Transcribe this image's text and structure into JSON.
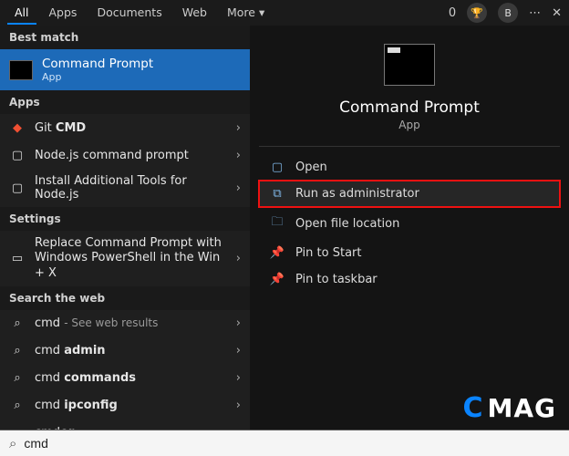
{
  "tabs": {
    "all": "All",
    "apps": "Apps",
    "documents": "Documents",
    "web": "Web",
    "more": "More",
    "points": "0",
    "avatar": "B"
  },
  "bestMatch": {
    "header": "Best match",
    "title": "Command Prompt",
    "subtitle": "App"
  },
  "appsHeader": "Apps",
  "appItems": [
    {
      "label_html": "Git <b>CMD</b>"
    },
    {
      "label_html": "Node.js command prompt"
    },
    {
      "label_html": "Install Additional Tools for Node.js"
    }
  ],
  "settingsHeader": "Settings",
  "settingsItem": "Replace Command Prompt with Windows PowerShell in the Win + X",
  "webHeader": "Search the web",
  "webItems": [
    {
      "label_html": "cmd <span class='dim'>- See web results</span>"
    },
    {
      "label_html": "cmd <b>admin</b>"
    },
    {
      "label_html": "cmd <b>commands</b>"
    },
    {
      "label_html": "cmd <b>ipconfig</b>"
    },
    {
      "label_html": "cmd<b>er</b>"
    }
  ],
  "preview": {
    "title": "Command Prompt",
    "subtitle": "App"
  },
  "actions": {
    "open": "Open",
    "runadmin": "Run as administrator",
    "openloc": "Open file location",
    "pinstart": "Pin to Start",
    "pintaskbar": "Pin to taskbar"
  },
  "search": {
    "value": "cmd"
  },
  "watermark": "MAG"
}
